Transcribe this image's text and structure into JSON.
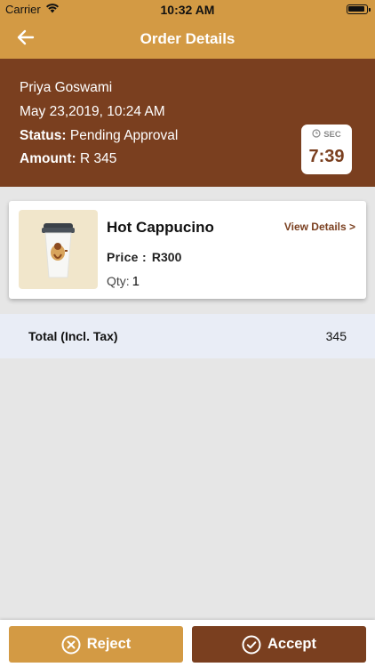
{
  "status_bar": {
    "carrier": "Carrier",
    "time": "10:32 AM"
  },
  "nav": {
    "title": "Order Details"
  },
  "order": {
    "customer": "Priya Goswami",
    "date": "May 23,2019, 10:24 AM",
    "status_label": "Status:",
    "status_value": "Pending Approval",
    "amount_label": "Amount:",
    "amount_value": "R 345"
  },
  "timer": {
    "unit": "SEC",
    "value": "7:39"
  },
  "item": {
    "name": "Hot Cappucino",
    "view_details": "View Details >",
    "price_label": "Price :",
    "price_value": "R300",
    "qty_label": "Qty:",
    "qty_value": "1"
  },
  "total": {
    "label": "Total (Incl. Tax)",
    "value": "345"
  },
  "actions": {
    "reject_label": "Reject",
    "accept_label": "Accept"
  },
  "colors": {
    "primary_gold": "#d39a44",
    "primary_brown": "#7a3f1f",
    "total_bg": "#e9edf6",
    "page_bg": "#e6e6e6"
  },
  "icons": {
    "back": "arrow-left-icon",
    "timer": "clock-icon",
    "reject": "close-circle-icon",
    "accept": "check-circle-icon",
    "wifi": "wifi-icon",
    "battery": "battery-icon",
    "item": "coffee-cup-icon"
  }
}
